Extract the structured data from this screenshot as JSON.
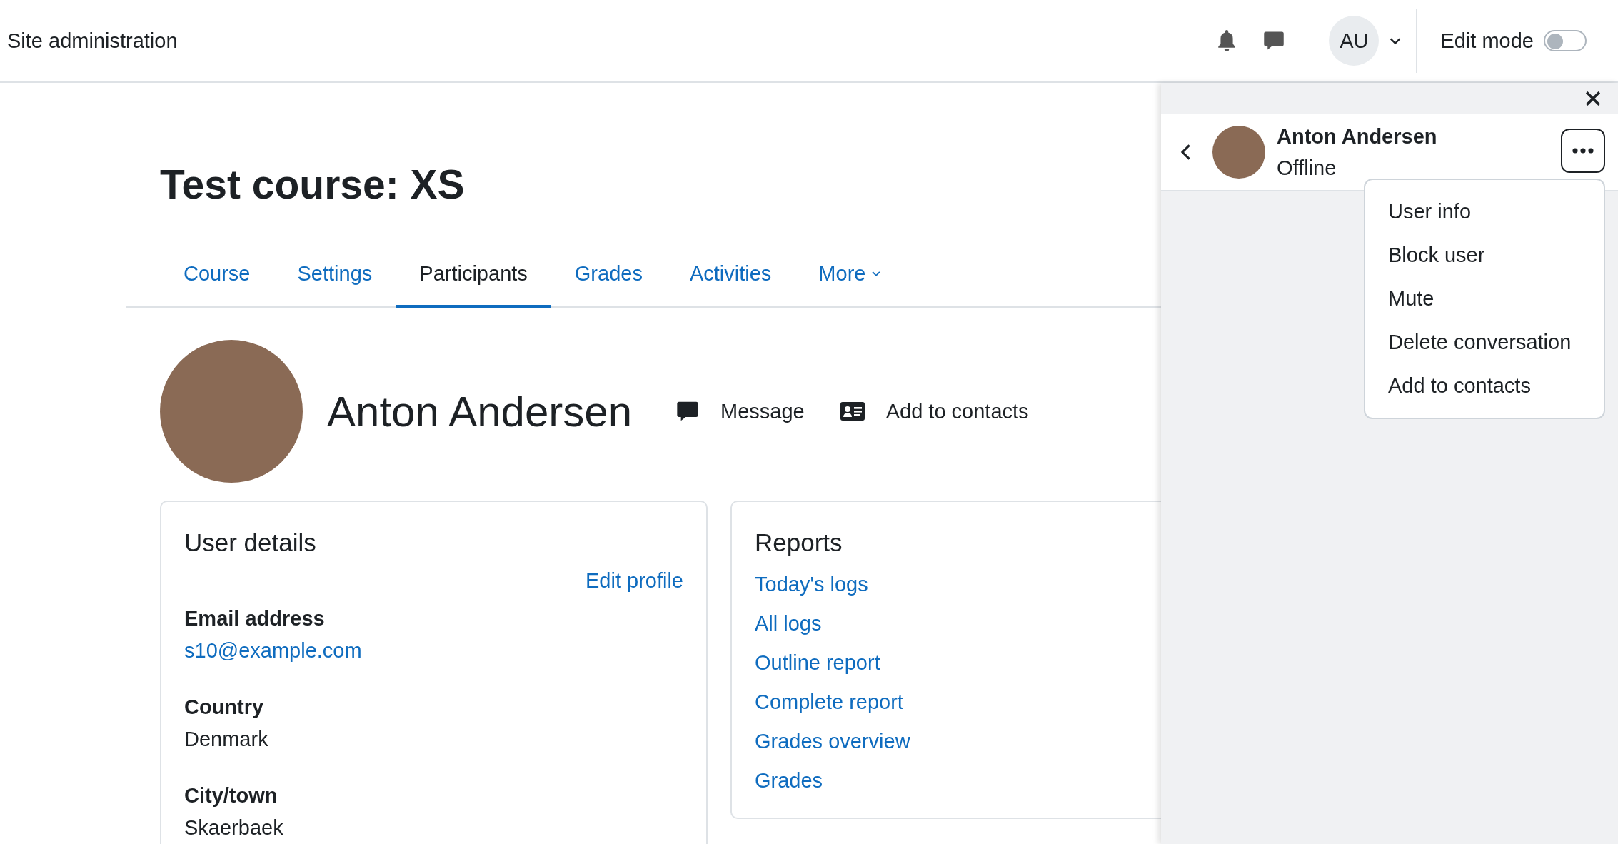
{
  "header": {
    "title": "Site administration",
    "avatar_initials": "AU",
    "edit_mode": {
      "label": "Edit mode",
      "on": false
    }
  },
  "course": {
    "title": "Test course: XS",
    "tabs": [
      {
        "label": "Course",
        "selected": false,
        "kind": "link"
      },
      {
        "label": "Settings",
        "selected": false,
        "kind": "link"
      },
      {
        "label": "Participants",
        "selected": true,
        "kind": "link"
      },
      {
        "label": "Grades",
        "selected": false,
        "kind": "link"
      },
      {
        "label": "Activities",
        "selected": false,
        "kind": "link"
      },
      {
        "label": "More",
        "selected": false,
        "kind": "menu"
      }
    ]
  },
  "profile": {
    "name": "Anton Andersen",
    "actions": [
      {
        "kind": "message",
        "label": "Message"
      },
      {
        "kind": "contact",
        "label": "Add to contacts"
      }
    ]
  },
  "user_details": {
    "title": "User details",
    "edit_link": "Edit profile",
    "fields": [
      {
        "label": "Email address",
        "value": "s10@example.com",
        "kind": "link"
      },
      {
        "label": "Country",
        "value": "Denmark",
        "kind": "text"
      },
      {
        "label": "City/town",
        "value": "Skaerbaek",
        "kind": "text"
      }
    ]
  },
  "reports": {
    "title": "Reports",
    "links": [
      "Today's logs",
      "All logs",
      "Outline report",
      "Complete report",
      "Grades overview",
      "Grades"
    ]
  },
  "drawer": {
    "contact": {
      "name": "Anton Andersen",
      "status": "Offline"
    },
    "menu": {
      "open": true,
      "items": [
        "User info",
        "Block user",
        "Mute",
        "Delete conversation",
        "Add to contacts"
      ]
    }
  }
}
